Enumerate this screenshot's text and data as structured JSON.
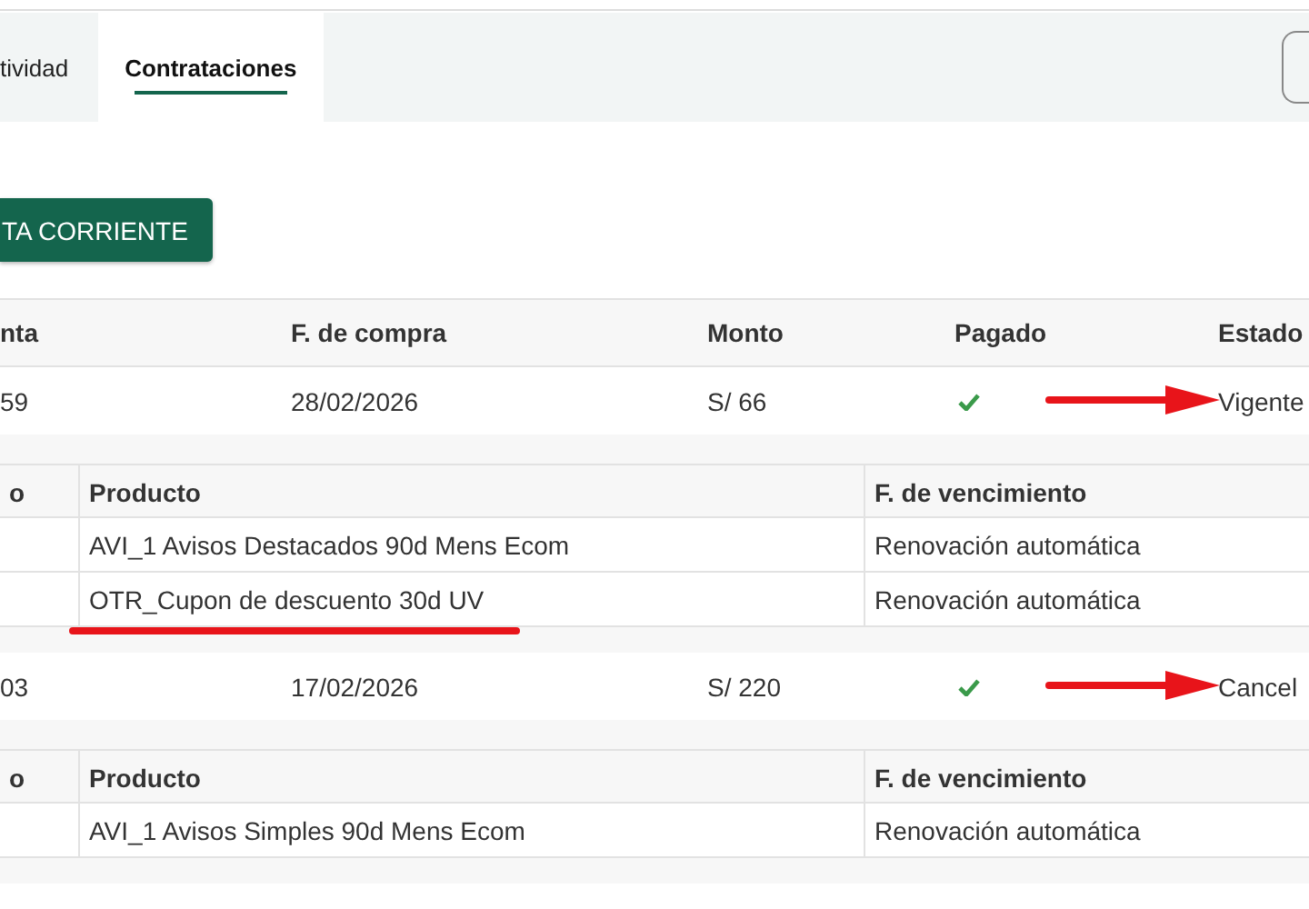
{
  "tabs": [
    {
      "label": "tividad",
      "selected": false
    },
    {
      "label": "Contrataciones",
      "selected": true
    }
  ],
  "action_button": "TA CORRIENTE",
  "table": {
    "columns": [
      "nta",
      "F. de compra",
      "Monto",
      "Pagado",
      "Estado"
    ],
    "orders": [
      {
        "cells": [
          "59",
          "28/02/2026",
          "S/ 66"
        ],
        "paid": true,
        "status": "Vigente",
        "arrow": true,
        "items": {
          "columns": [
            "o",
            "Producto",
            "F. de vencimiento"
          ],
          "rows": [
            {
              "product": "AVI_1 Avisos Destacados 90d Mens Ecom",
              "expiry": "Renovación automática",
              "underlined": false
            },
            {
              "product": "OTR_Cupon de descuento 30d UV",
              "expiry": "Renovación automática",
              "underlined": true
            }
          ]
        }
      },
      {
        "cells": [
          "03",
          "17/02/2026",
          "S/ 220"
        ],
        "paid": true,
        "status": "Cancel",
        "arrow": true,
        "items": {
          "columns": [
            "o",
            "Producto",
            "F. de vencimiento"
          ],
          "rows": [
            {
              "product": "AVI_1 Avisos Simples 90d Mens Ecom",
              "expiry": "Renovación automática",
              "underlined": false
            }
          ]
        }
      }
    ]
  }
}
